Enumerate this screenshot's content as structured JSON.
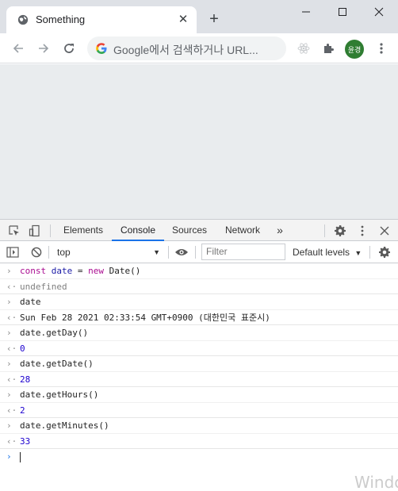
{
  "browser": {
    "tab_title": "Something",
    "omnibox_placeholder": "Google에서 검색하거나 URL...",
    "avatar_text": "윤경",
    "accent": "#1a73e8"
  },
  "devtools": {
    "tabs": [
      "Elements",
      "Console",
      "Sources",
      "Network"
    ],
    "more_tabs": "»",
    "context": "top",
    "filter_placeholder": "Filter",
    "levels": "Default levels"
  },
  "console": {
    "entries": [
      {
        "type": "input",
        "text": "const date = new Date()"
      },
      {
        "type": "output",
        "text": "undefined"
      },
      {
        "type": "input",
        "text": "date"
      },
      {
        "type": "output",
        "text": "Sun Feb 28 2021 02:33:54 GMT+0900 (대한민국 표준시)"
      },
      {
        "type": "input",
        "text": "date.getDay()"
      },
      {
        "type": "output",
        "text": "0"
      },
      {
        "type": "input",
        "text": "date.getDate()"
      },
      {
        "type": "output",
        "text": "28"
      },
      {
        "type": "input",
        "text": "date.getHours()"
      },
      {
        "type": "output",
        "text": "2"
      },
      {
        "type": "input",
        "text": "date.getMinutes()"
      },
      {
        "type": "output",
        "text": "33"
      }
    ]
  },
  "watermark": "Windo"
}
